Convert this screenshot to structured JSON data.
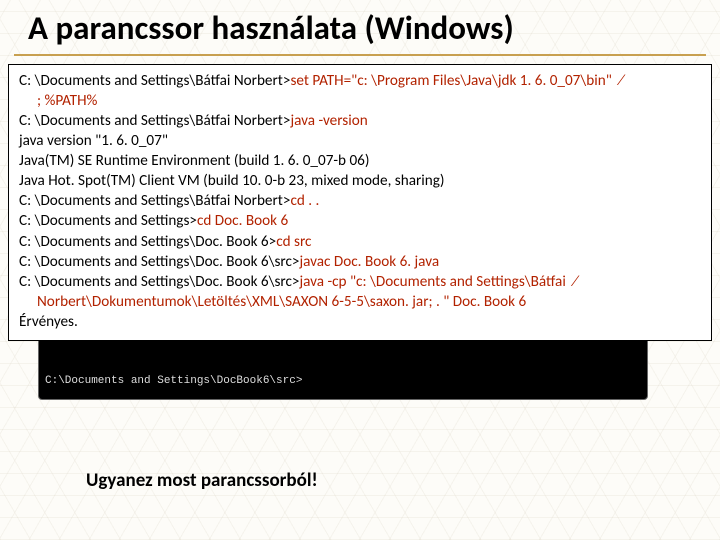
{
  "title": "A parancssor használata (Windows)",
  "terminal_prompt": "C:\\Documents and Settings\\DocBook6\\src>",
  "code": {
    "l1a": "C: \\Documents and Settings\\Bátfai Norbert>",
    "l1b": "set PATH=\"c: \\Program Files\\Java\\jdk 1. 6. 0_07\\bin\"  ⁄",
    "l1c": "; %PATH%",
    "l2a": "C: \\Documents and Settings\\Bátfai Norbert>",
    "l2b": "java -version",
    "l3": "java version \"1. 6. 0_07\"",
    "l4": "Java(TM) SE Runtime Environment (build 1. 6. 0_07-b 06)",
    "l5": "Java Hot. Spot(TM) Client VM (build 10. 0-b 23, mixed mode, sharing)",
    "l6a": "C: \\Documents and Settings\\Bátfai Norbert>",
    "l6b": "cd . .",
    "l7a": "C: \\Documents and Settings>",
    "l7b": "cd Doc. Book 6",
    "l8a": "C: \\Documents and Settings\\Doc. Book 6>",
    "l8b": "cd src",
    "l9a": "C: \\Documents and Settings\\Doc. Book 6\\src>",
    "l9b": "javac Doc. Book 6. java",
    "l10a": "C: \\Documents and Settings\\Doc. Book 6\\src>",
    "l10b": "java -cp \"c: \\Documents and Settings\\Bátfai  ⁄",
    "l10c": "Norbert\\Dokumentumok\\Letöltés\\XML\\SAXON 6-5-5\\saxon. jar; . \" Doc. Book 6",
    "l11": "Érvényes."
  },
  "caption": "Ugyanez most parancssorból!"
}
